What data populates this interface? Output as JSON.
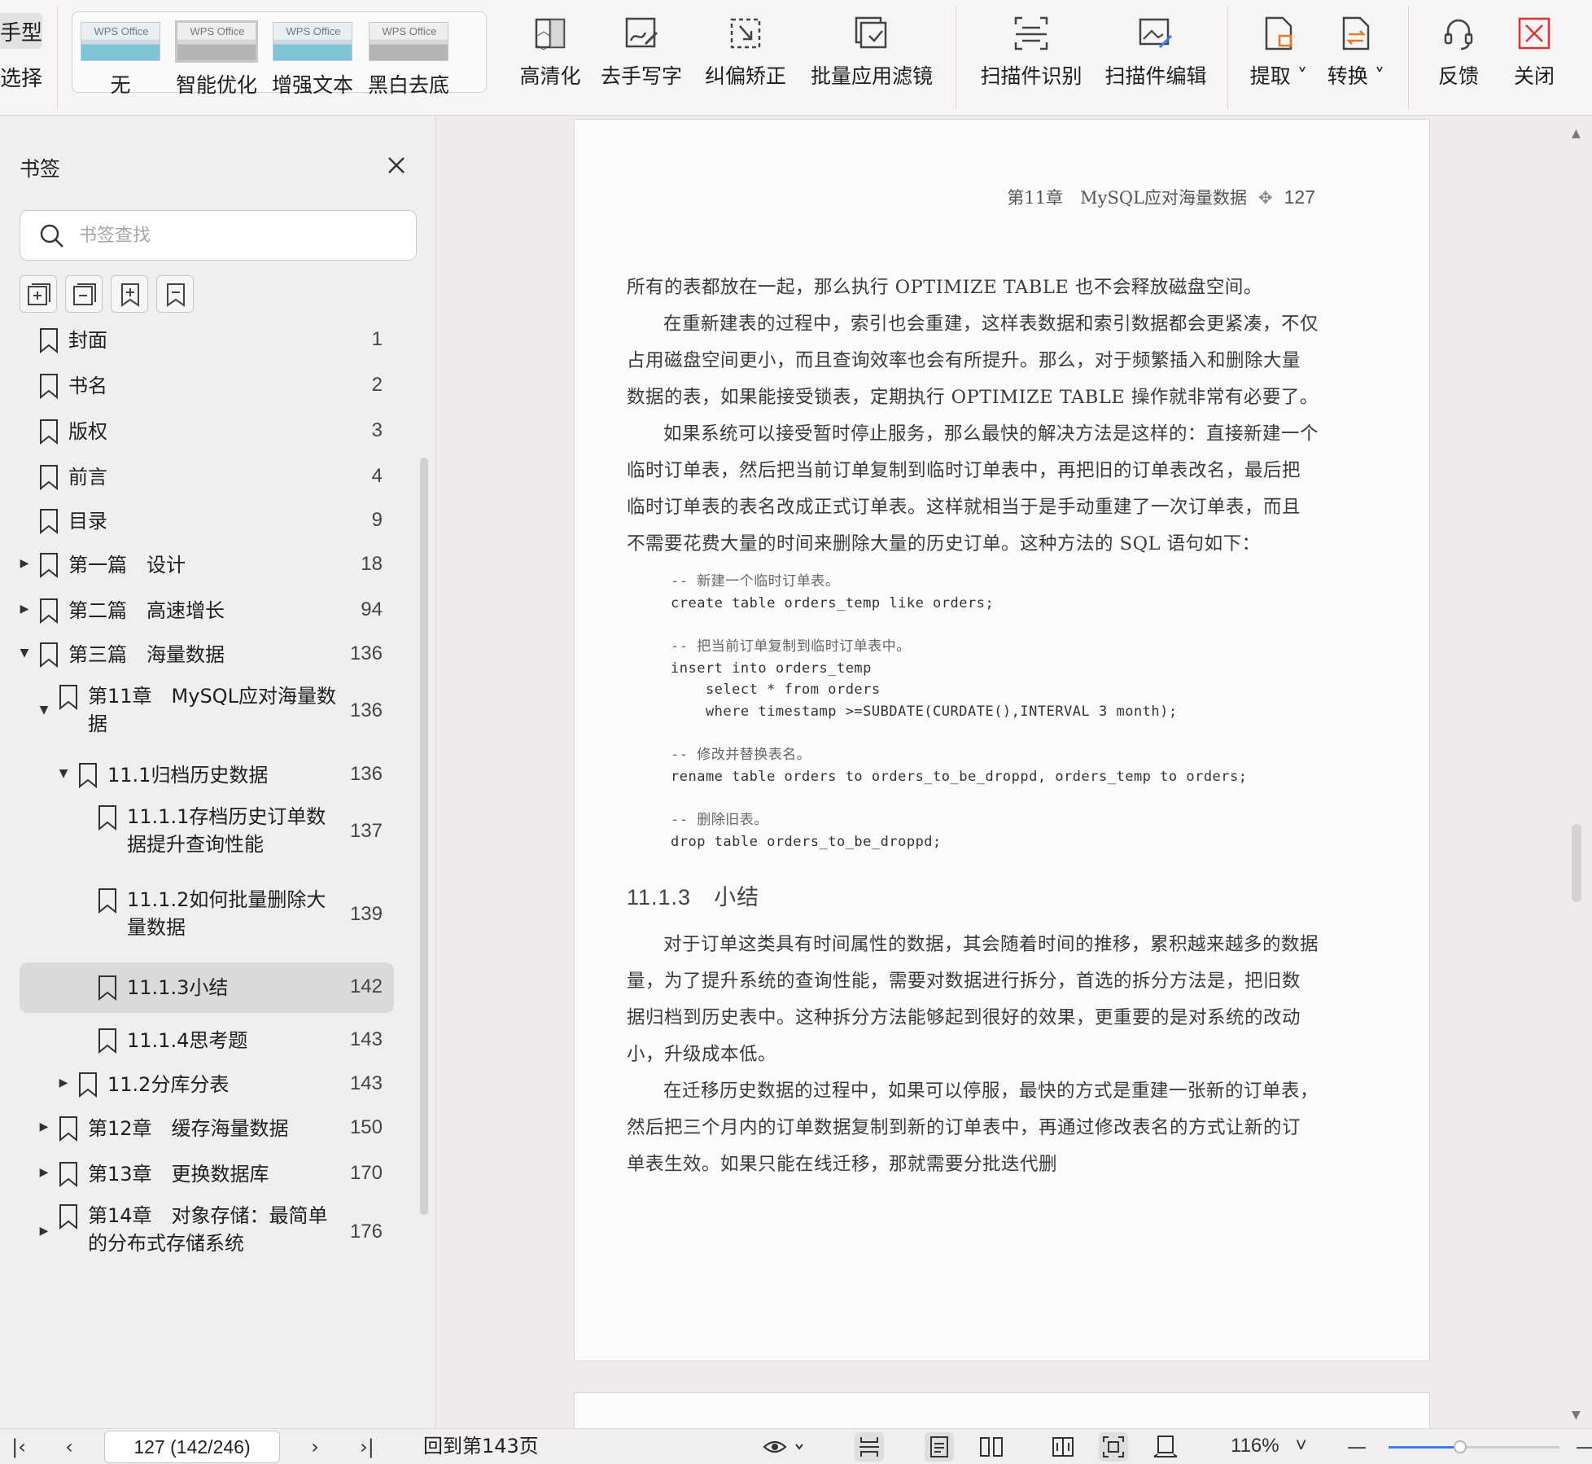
{
  "toolbar": {
    "cut_labels": [
      "手型",
      "选择"
    ],
    "filters": [
      {
        "label": "无",
        "thumb": "WPS Office"
      },
      {
        "label": "智能优化",
        "thumb": "WPS Office"
      },
      {
        "label": "增强文本",
        "thumb": "WPS Office"
      },
      {
        "label": "黑白去底",
        "thumb": "WPS Office"
      }
    ],
    "tools": [
      {
        "label": "高清化",
        "icon": "hd-icon"
      },
      {
        "label": "去手写字",
        "icon": "remove-handwriting-icon"
      },
      {
        "label": "纠偏矫正",
        "icon": "deskew-icon"
      },
      {
        "label": "批量应用滤镜",
        "icon": "batch-filter-icon"
      },
      {
        "label": "扫描件识别",
        "icon": "scan-recognize-icon"
      },
      {
        "label": "扫描件编辑",
        "icon": "scan-edit-icon"
      },
      {
        "label": "提取",
        "icon": "extract-icon"
      },
      {
        "label": "转换",
        "icon": "convert-icon"
      },
      {
        "label": "反馈",
        "icon": "feedback-icon"
      },
      {
        "label": "关闭",
        "icon": "close-icon"
      }
    ]
  },
  "sidebar": {
    "title": "书签",
    "search_placeholder": "书签查找",
    "bookmarks": [
      {
        "label": "封面",
        "page": "1",
        "level": 0,
        "expander": ""
      },
      {
        "label": "书名",
        "page": "2",
        "level": 0,
        "expander": ""
      },
      {
        "label": "版权",
        "page": "3",
        "level": 0,
        "expander": ""
      },
      {
        "label": "前言",
        "page": "4",
        "level": 0,
        "expander": ""
      },
      {
        "label": "目录",
        "page": "9",
        "level": 0,
        "expander": ""
      },
      {
        "label": "第一篇　设计",
        "page": "18",
        "level": 0,
        "expander": "collapsed"
      },
      {
        "label": "第二篇　高速增长",
        "page": "94",
        "level": 0,
        "expander": "collapsed"
      },
      {
        "label": "第三篇　海量数据",
        "page": "136",
        "level": 0,
        "expander": "expanded"
      },
      {
        "label": "第11章　MySQL应对海量数据",
        "page": "136",
        "level": 1,
        "expander": "expanded"
      },
      {
        "label": "11.1归档历史数据",
        "page": "136",
        "level": 2,
        "expander": "expanded"
      },
      {
        "label": "11.1.1存档历史订单数据提升查询性能",
        "page": "137",
        "level": 3,
        "expander": ""
      },
      {
        "label": "11.1.2如何批量删除大量数据",
        "page": "139",
        "level": 3,
        "expander": ""
      },
      {
        "label": "11.1.3小结",
        "page": "142",
        "level": 3,
        "expander": "",
        "active": true
      },
      {
        "label": "11.1.4思考题",
        "page": "143",
        "level": 3,
        "expander": ""
      },
      {
        "label": "11.2分库分表",
        "page": "143",
        "level": 2,
        "expander": "collapsed"
      },
      {
        "label": "第12章　缓存海量数据",
        "page": "150",
        "level": 1,
        "expander": "collapsed"
      },
      {
        "label": "第13章　更换数据库",
        "page": "170",
        "level": 1,
        "expander": "collapsed"
      },
      {
        "label": "第14章　对象存储：最简单的分布式存储系统",
        "page": "176",
        "level": 1,
        "expander": "collapsed"
      }
    ]
  },
  "document": {
    "header": "第11章　MySQL应对海量数据",
    "page_number": "127",
    "paragraphs": [
      {
        "text": "所有的表都放在一起，那么执行 OPTIMIZE TABLE 也不会释放磁盘空间。",
        "indent": false
      },
      {
        "text": "在重新建表的过程中，索引也会重建，这样表数据和索引数据都会更紧凑，不仅占用磁盘空间更小，而且查询效率也会有所提升。那么，对于频繁插入和删除大量数据的表，如果能接受锁表，定期执行 OPTIMIZE TABLE 操作就非常有必要了。",
        "indent": true
      },
      {
        "text": "如果系统可以接受暂时停止服务，那么最快的解决方法是这样的：直接新建一个临时订单表，然后把当前订单复制到临时订单表中，再把旧的订单表改名，最后把临时订单表的表名改成正式订单表。这样就相当于是手动重建了一次订单表，而且不需要花费大量的时间来删除大量的历史订单。这种方法的 SQL 语句如下：",
        "indent": true
      }
    ],
    "code_blocks": [
      [
        "-- 新建一个临时订单表。",
        "create table orders_temp like orders;"
      ],
      [
        "-- 把当前订单复制到临时订单表中。",
        "insert into orders_temp",
        "    select * from orders",
        "    where timestamp >=SUBDATE(CURDATE(),INTERVAL 3 month);"
      ],
      [
        "-- 修改并替换表名。",
        "rename table orders to orders_to_be_droppd, orders_temp to orders;"
      ],
      [
        "-- 删除旧表。",
        "drop table orders_to_be_droppd;"
      ]
    ],
    "section_title": "11.1.3　小结",
    "summary_paragraphs": [
      "对于订单这类具有时间属性的数据，其会随着时间的推移，累积越来越多的数据量，为了提升系统的查询性能，需要对数据进行拆分，首选的拆分方法是，把旧数据归档到历史表中。这种拆分方法能够起到很好的效果，更重要的是对系统的改动小，升级成本低。",
      "在迁移历史数据的过程中，如果可以停服，最快的方式是重建一张新的订单表，然后把三个月内的订单数据复制到新的订单表中，再通过修改表名的方式让新的订单表生效。如果只能在线迁移，那就需要分批迭代删"
    ]
  },
  "statusbar": {
    "page_field": "127 (142/246)",
    "goto_label": "回到第143页",
    "zoom": "116%",
    "zoom_fraction": 0.42
  }
}
